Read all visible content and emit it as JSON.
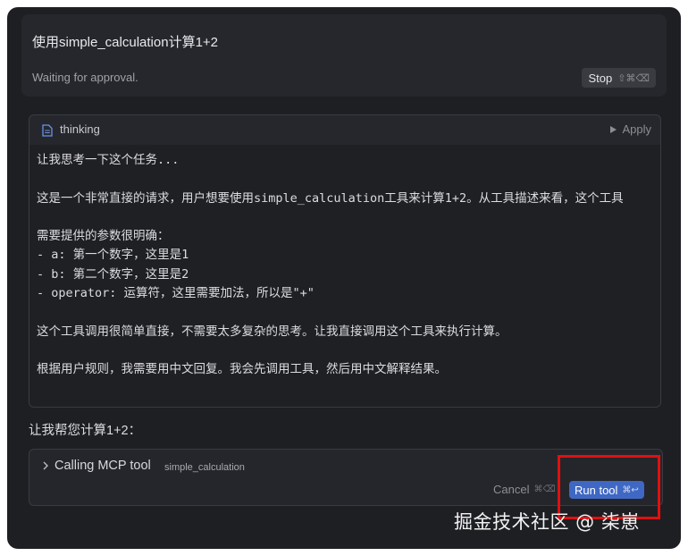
{
  "prompt": {
    "text": "使用simple_calculation计算1+2",
    "status": "Waiting for approval.",
    "stop_label": "Stop",
    "stop_shortcut": "⇧⌘⌫"
  },
  "thinking": {
    "title": "thinking",
    "apply_label": "Apply",
    "icon": "document-icon",
    "content": "让我思考一下这个任务...\n\n这是一个非常直接的请求，用户想要使用simple_calculation工具来计算1+2。从工具描述来看，这个工具\n\n需要提供的参数很明确：\n- a: 第一个数字，这里是1\n- b: 第二个数字，这里是2\n- operator: 运算符，这里需要加法，所以是\"+\"\n\n这个工具调用很简单直接，不需要太多复杂的思考。让我直接调用这个工具来执行计算。\n\n根据用户规则，我需要用中文回复。我会先调用工具，然后用中文解释结果。"
  },
  "assistant": {
    "text": "让我帮您计算1+2："
  },
  "tool_call": {
    "label": "Calling MCP tool",
    "tool_name": "simple_calculation",
    "cancel_label": "Cancel",
    "cancel_shortcut": "⌘⌫",
    "run_label": "Run tool",
    "run_shortcut": "⌘↩"
  },
  "watermark": "掘金技术社区 @ 柒崽",
  "colors": {
    "background": "#1e1f23",
    "accent": "#3f68c4",
    "highlight": "#e01010"
  }
}
